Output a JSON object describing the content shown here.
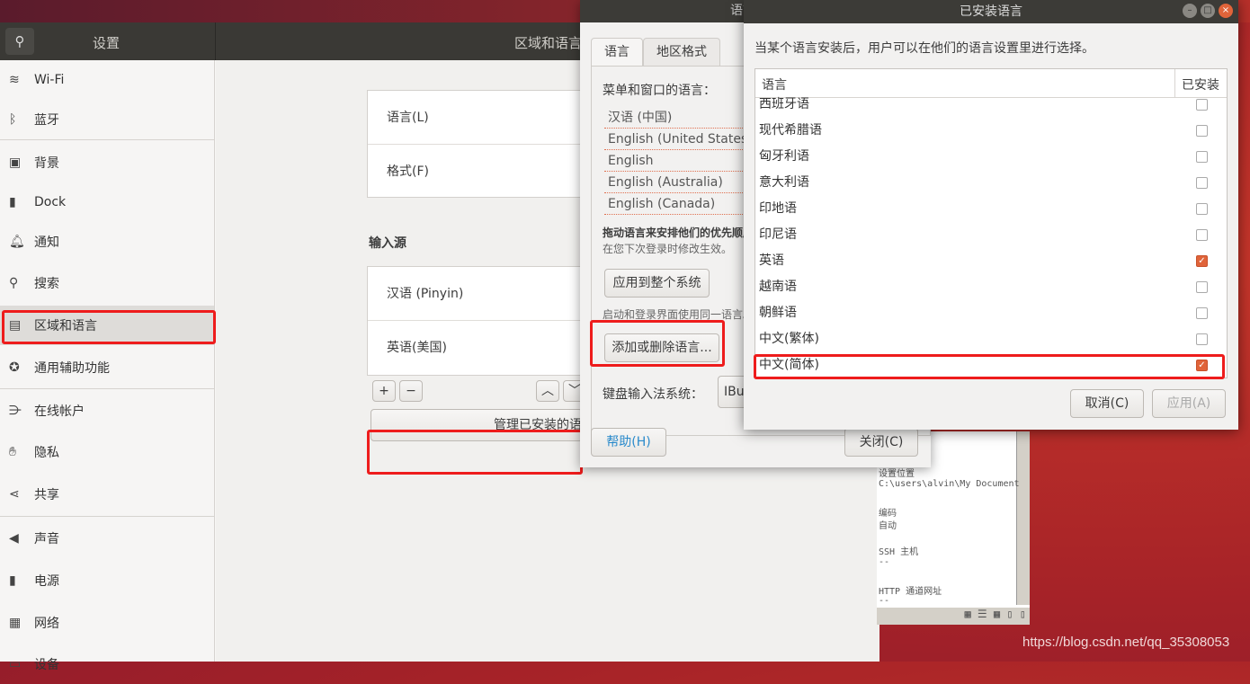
{
  "settings": {
    "title": "设置",
    "panel_title": "区域和语言",
    "sidebar": [
      {
        "label": "Wi-Fi",
        "icon": "wifi-icon",
        "glyph": "≋"
      },
      {
        "label": "蓝牙",
        "icon": "bluetooth-icon",
        "glyph": "ᛒ"
      },
      {
        "label": "背景",
        "icon": "background-icon",
        "glyph": "▣"
      },
      {
        "label": "Dock",
        "icon": "dock-icon",
        "glyph": "▮"
      },
      {
        "label": "通知",
        "icon": "bell-icon",
        "glyph": "🔔︎"
      },
      {
        "label": "搜索",
        "icon": "search-icon",
        "glyph": "⚲"
      },
      {
        "label": "区域和语言",
        "icon": "region-icon",
        "glyph": "▤"
      },
      {
        "label": "通用辅助功能",
        "icon": "accessibility-icon",
        "glyph": "✪"
      },
      {
        "label": "在线帐户",
        "icon": "online-accounts-icon",
        "glyph": "⋺"
      },
      {
        "label": "隐私",
        "icon": "hand-icon",
        "glyph": "✋︎"
      },
      {
        "label": "共享",
        "icon": "share-icon",
        "glyph": "⋖"
      },
      {
        "label": "声音",
        "icon": "speaker-icon",
        "glyph": "◀︎"
      },
      {
        "label": "电源",
        "icon": "power-icon",
        "glyph": "▮"
      },
      {
        "label": "网络",
        "icon": "network-icon",
        "glyph": "▦"
      },
      {
        "label": "设备",
        "icon": "devices-icon",
        "glyph": "▭"
      }
    ],
    "selected": "区域和语言",
    "language_label": "语言(L)",
    "formats_label": "格式(F)",
    "input_sources_title": "输入源",
    "input_sources": [
      "汉语 (Pinyin)",
      "英语(美国)"
    ],
    "add": "+",
    "remove": "−",
    "manage_button": "管理已安装的语言"
  },
  "language_support": {
    "title": "语言支持",
    "tabs": [
      "语言",
      "地区格式"
    ],
    "menu_lang_label": "菜单和窗口的语言：",
    "languages": [
      "汉语 (中国)",
      "English (United States)",
      "English",
      "English (Australia)",
      "English (Canada)"
    ],
    "drag_hint": "拖动语言来安排他们的优先顺序。",
    "effect_hint": "在您下次登录时修改生效。",
    "apply_system": "应用到整个系统",
    "login_hint": "启动和登录界面使用同一语言。",
    "add_remove": "添加或删除语言...",
    "ime_label": "键盘输入法系统：",
    "ime_value": "IBus",
    "help": "帮助(H)",
    "close": "关闭(C)"
  },
  "installed_languages": {
    "title": "已安装语言",
    "description": "当某个语言安装后，用户可以在他们的语言设置里进行选择。",
    "col_language": "语言",
    "col_installed": "已安装",
    "rows": [
      {
        "name": "西班牙语",
        "installed": false
      },
      {
        "name": "现代希腊语",
        "installed": false
      },
      {
        "name": "匈牙利语",
        "installed": false
      },
      {
        "name": "意大利语",
        "installed": false
      },
      {
        "name": "印地语",
        "installed": false
      },
      {
        "name": "印尼语",
        "installed": false
      },
      {
        "name": "英语",
        "installed": true
      },
      {
        "name": "越南语",
        "installed": false
      },
      {
        "name": "朝鲜语",
        "installed": false
      },
      {
        "name": "中文(繁体)",
        "installed": false
      },
      {
        "name": "中文(简体)",
        "installed": true
      }
    ],
    "cancel": "取消(C)",
    "apply": "应用(A)"
  },
  "background_window": {
    "lines": [
      "设置位置",
      "C:\\users\\alvin\\My Document",
      "",
      "编码",
      "自动",
      "",
      "SSH 主机",
      "--",
      "",
      "HTTP 通道网址",
      "--"
    ]
  },
  "watermark": "https://blog.csdn.net/qq_35308053",
  "colors": {
    "highlight": "#ee1c1c",
    "checkbox": "#e0643a",
    "header": "#3a3935"
  }
}
